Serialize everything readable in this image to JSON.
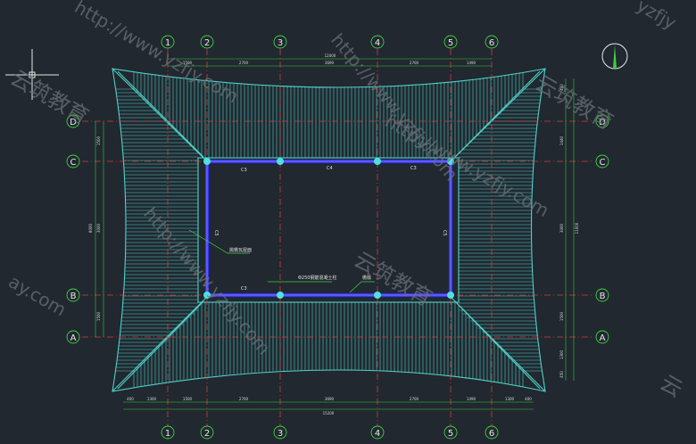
{
  "drawing": {
    "columns_top": [
      "1",
      "2",
      "3",
      "4",
      "5",
      "6"
    ],
    "columns_bottom": [
      "1",
      "2",
      "3",
      "4",
      "5",
      "6"
    ],
    "rows_left": [
      "D",
      "C",
      "B",
      "A"
    ],
    "rows_right": [
      "D",
      "C",
      "B",
      "A"
    ],
    "top_dims": [
      "1500",
      "2700",
      "3690",
      "2700",
      "1490"
    ],
    "top_total": "12000",
    "bottom_dims": [
      "400",
      "1300",
      "1500",
      "2700",
      "3690",
      "2700",
      "1490",
      "1300",
      "400"
    ],
    "bottom_total": "15200",
    "left_dims": [
      "1500",
      "3000",
      "1500"
    ],
    "left_total": "8000",
    "right_dims": [
      "450",
      "1440",
      "3000",
      "1500",
      "1300",
      "450"
    ],
    "right_total": "11000",
    "beam_labels": [
      "C3",
      "C4",
      "C3",
      "C3",
      "C5",
      "C5"
    ],
    "notes": [
      "挑檐瓦屋面",
      "Φ250钢筋混凝土柱",
      "檐檩"
    ]
  },
  "watermark": {
    "url": "http://www.yzfjy.com",
    "brand": "云筑教育",
    "partial": [
      "yzfjy",
      "云筑教育",
      "ay.com",
      "云"
    ]
  },
  "colors": {
    "background": "#212830",
    "roof_lines": "#4fd1c7",
    "axis_red": "#d23c3c",
    "axis_bubble": "#3fd03f",
    "beam_blue": "#3535ff",
    "dim_green": "#33cc33"
  }
}
